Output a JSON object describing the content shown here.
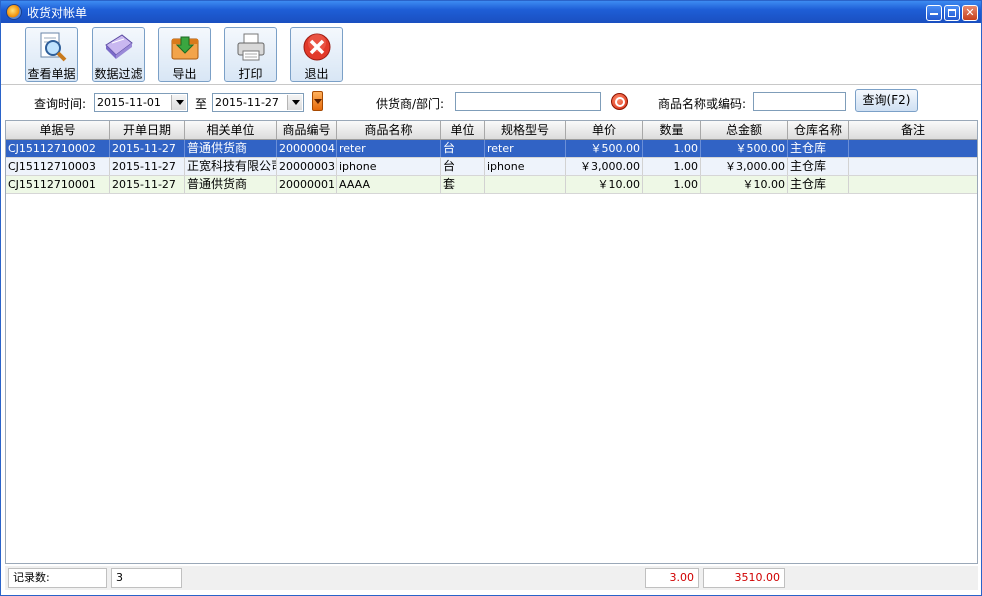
{
  "window": {
    "title": "收货对帐单",
    "controls": {
      "minimize": "",
      "maximize": "",
      "close": "✕"
    }
  },
  "toolbar": [
    {
      "id": "view",
      "label": "查看单据",
      "icon": "magnifier-document-icon"
    },
    {
      "id": "filter",
      "label": "数据过滤",
      "icon": "filter-book-icon"
    },
    {
      "id": "export",
      "label": "导出",
      "icon": "export-arrow-icon"
    },
    {
      "id": "print",
      "label": "打印",
      "icon": "printer-icon"
    },
    {
      "id": "exit",
      "label": "退出",
      "icon": "exit-x-icon"
    }
  ],
  "filter": {
    "date_label": "查询时间:",
    "date_from": "2015-11-01",
    "to_label": "至",
    "date_to": "2015-11-27",
    "supplier_label": "供货商/部门:",
    "supplier_value": "",
    "product_label": "商品名称或编码:",
    "product_value": "",
    "query_button": "查询(F2)"
  },
  "grid": {
    "columns": [
      "单据号",
      "开单日期",
      "相关单位",
      "商品编号",
      "商品名称",
      "单位",
      "规格型号",
      "单价",
      "数量",
      "总金额",
      "仓库名称",
      "备注"
    ],
    "rows": [
      [
        "CJ15112710002",
        "2015-11-27",
        "普通供货商",
        "20000004",
        "reter",
        "台",
        "reter",
        "￥500.00",
        "1.00",
        "￥500.00",
        "主仓库",
        ""
      ],
      [
        "CJ15112710003",
        "2015-11-27",
        "正宽科技有限公司",
        "20000003",
        "iphone",
        "台",
        "iphone",
        "￥3,000.00",
        "1.00",
        "￥3,000.00",
        "主仓库",
        ""
      ],
      [
        "CJ15112710001",
        "2015-11-27",
        "普通供货商",
        "20000001",
        "AAAA",
        "套",
        "",
        "￥10.00",
        "1.00",
        "￥10.00",
        "主仓库",
        ""
      ]
    ]
  },
  "footer": {
    "count_label": "记录数:",
    "count_value": "3",
    "qty_total": "3.00",
    "amount_total": "3510.00"
  },
  "colors": {
    "title_bar": "#1e5ed6",
    "selected_row": "#3163c5",
    "totals_text": "#d00000"
  }
}
